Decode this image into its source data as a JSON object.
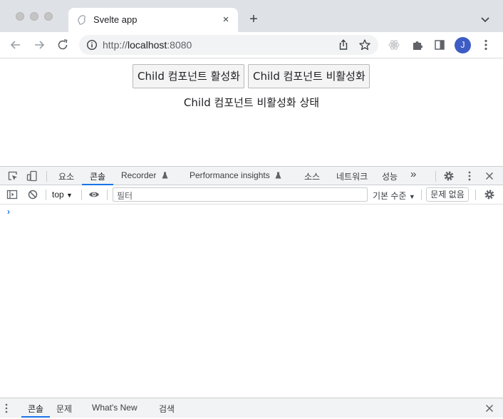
{
  "browser": {
    "tab": {
      "title": "Svelte app",
      "favicon": "svelte-icon",
      "close": "×"
    },
    "new_tab": "+",
    "url_scheme": "http://",
    "url_host": "localhost",
    "url_rest": ":8080",
    "avatar_initial": "J"
  },
  "page": {
    "buttons": [
      "Child 컴포넌트 활성화",
      "Child 컴포넌트 비활성화"
    ],
    "status": "Child 컴포넌트 비활성화 상태"
  },
  "devtools": {
    "tabs": [
      "요소",
      "콘솔",
      "Recorder",
      "Performance insights",
      "소스",
      "네트워크",
      "성능"
    ],
    "active_tab": "콘솔",
    "more": "»",
    "console": {
      "context": "top",
      "filter_placeholder": "필터",
      "levels": "기본 수준",
      "issues": "문제 없음",
      "prompt": "›"
    },
    "drawer_tabs": [
      "콘솔",
      "문제",
      "What's New",
      "검색"
    ],
    "accent_color": "#1a73e8"
  }
}
